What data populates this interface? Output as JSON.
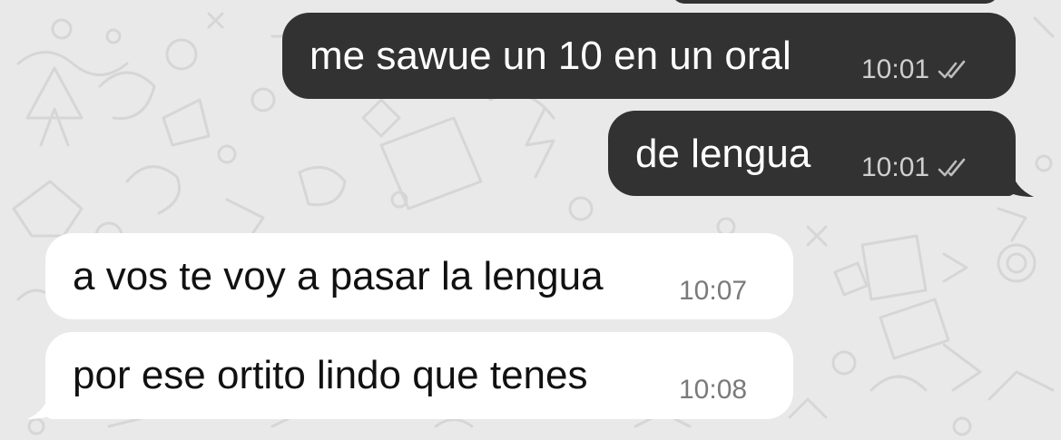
{
  "messages": [
    {
      "direction": "outgoing",
      "text": "me sawue un 10 en un oral",
      "time": "10:01",
      "status": "read-double-check"
    },
    {
      "direction": "outgoing",
      "text": "de lengua",
      "time": "10:01",
      "status": "read-double-check"
    },
    {
      "direction": "incoming",
      "text": "a vos te voy a pasar la lengua",
      "time": "10:07"
    },
    {
      "direction": "incoming",
      "text": "por ese ortito lindo que tenes",
      "time": "10:08"
    }
  ],
  "colors": {
    "background": "#e9e9e9",
    "outgoing_bubble": "#323232",
    "incoming_bubble": "#ffffff",
    "outgoing_text": "#ffffff",
    "incoming_text": "#111111"
  }
}
